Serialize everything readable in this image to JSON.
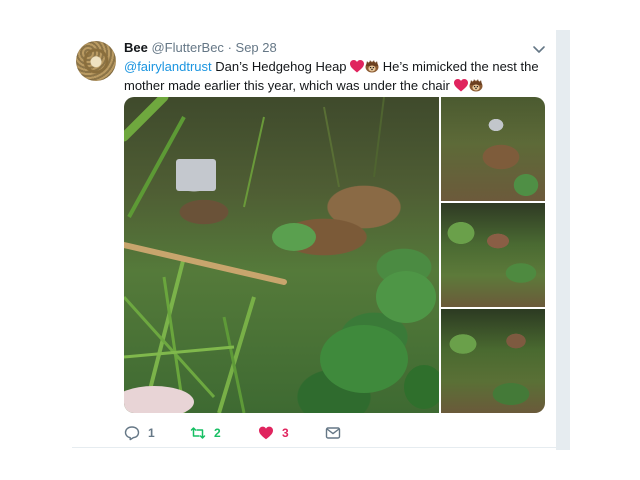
{
  "tweet": {
    "author": {
      "name": "Bee",
      "handle": "@FlutterBec",
      "separator": "·",
      "date": "Sep 28"
    },
    "text": {
      "mention": "@fairylandtrust",
      "line1": " Dan’s Hedgehog Heap ",
      "line2": " He’s mimicked the nest the mother made earlier this year, which was under the chair "
    },
    "emoji": [
      "red-heart",
      "hedgehog"
    ],
    "media": {
      "photos": [
        "garden-nest-main",
        "garden-nest-detail-1",
        "garden-nest-detail-2",
        "garden-nest-detail-3"
      ]
    },
    "actions": {
      "reply_count": "1",
      "retweet_count": "2",
      "like_count": "3"
    },
    "colors": {
      "mention": "#1b95e0",
      "retweet": "#17bf63",
      "like": "#e0245e",
      "muted": "#657786"
    }
  }
}
